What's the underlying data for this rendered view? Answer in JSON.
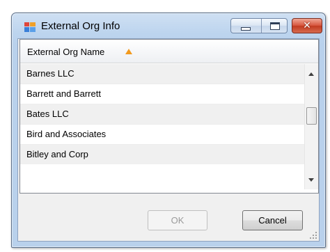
{
  "window": {
    "title": "External Org Info",
    "close_glyph": "✕"
  },
  "grid": {
    "column_header": "External Org Name",
    "sort": "ascending",
    "rows": [
      "Barnes LLC",
      "Barrett and Barrett",
      "Bates LLC",
      "Bird and Associates",
      "Bitley and Corp"
    ]
  },
  "buttons": {
    "ok_label": "OK",
    "ok_enabled": false,
    "cancel_label": "Cancel"
  },
  "colors": {
    "sort_indicator": "#f29a1e",
    "close_button": "#c23a20"
  }
}
